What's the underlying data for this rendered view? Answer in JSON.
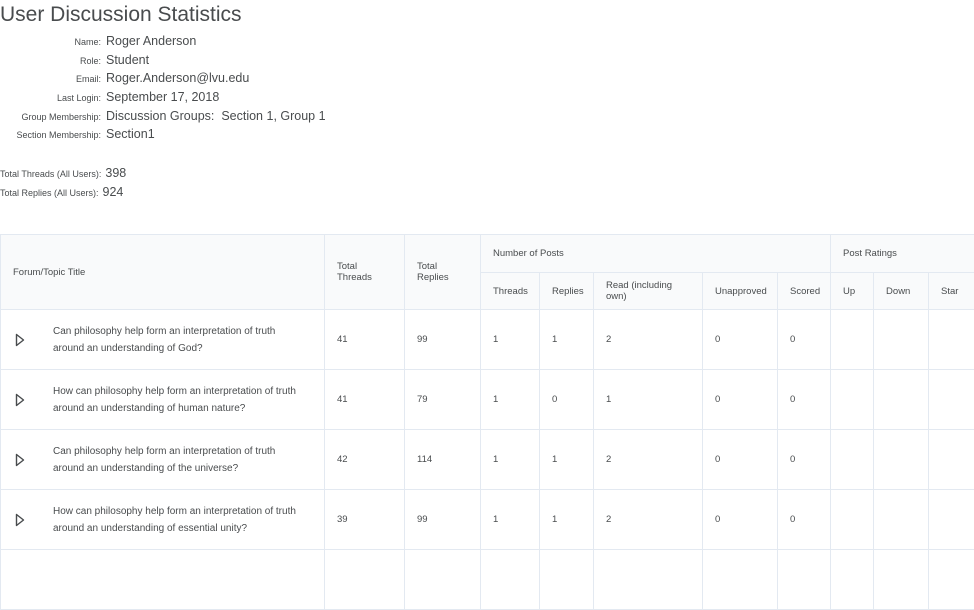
{
  "page": {
    "title": "User Discussion Statistics"
  },
  "user": [
    {
      "label": "Name:",
      "value": "Roger Anderson"
    },
    {
      "label": "Role:",
      "value": "Student"
    },
    {
      "label": "Email:",
      "value": "Roger.Anderson@lvu.edu"
    },
    {
      "label": "Last Login:",
      "value": "September 17, 2018"
    },
    {
      "label": "Group Membership:",
      "value": "Discussion Groups:  Section 1, Group 1"
    },
    {
      "label": "Section Membership:",
      "value": "Section1"
    }
  ],
  "totals": [
    {
      "label": "Total Threads (All Users):",
      "value": "398"
    },
    {
      "label": "Total Replies (All Users):",
      "value": "924"
    }
  ],
  "table": {
    "headers": {
      "topic": "Forum/Topic Title",
      "total_threads": "Total Threads",
      "total_replies": "Total Replies",
      "number_of_posts": "Number of Posts",
      "post_ratings": "Post Ratings",
      "threads": "Threads",
      "replies": "Replies",
      "read": "Read (including own)",
      "unapproved": "Unapproved",
      "scored": "Scored",
      "up": "Up",
      "down": "Down",
      "star": "Star"
    },
    "rows": [
      {
        "line1": "Can philosophy help form an interpretation of truth",
        "line2": "around an understanding of God?",
        "total_threads": "41",
        "total_replies": "99",
        "threads": "1",
        "replies": "1",
        "read": "2",
        "unapproved": "0",
        "scored": "0",
        "up": "",
        "down": "",
        "star": ""
      },
      {
        "line1": "How can philosophy help form an interpretation of truth",
        "line2": "around an understanding of human nature?",
        "total_threads": "41",
        "total_replies": "79",
        "threads": "1",
        "replies": "0",
        "read": "1",
        "unapproved": "0",
        "scored": "0",
        "up": "",
        "down": "",
        "star": ""
      },
      {
        "line1": "Can philosophy help form an interpretation of truth",
        "line2": "around an understanding of the universe?",
        "total_threads": "42",
        "total_replies": "114",
        "threads": "1",
        "replies": "1",
        "read": "2",
        "unapproved": "0",
        "scored": "0",
        "up": "",
        "down": "",
        "star": ""
      },
      {
        "line1": "How can philosophy help form an interpretation of truth",
        "line2": "around an understanding of essential unity?",
        "total_threads": "39",
        "total_replies": "99",
        "threads": "1",
        "replies": "1",
        "read": "2",
        "unapproved": "0",
        "scored": "0",
        "up": "",
        "down": "",
        "star": ""
      }
    ]
  }
}
